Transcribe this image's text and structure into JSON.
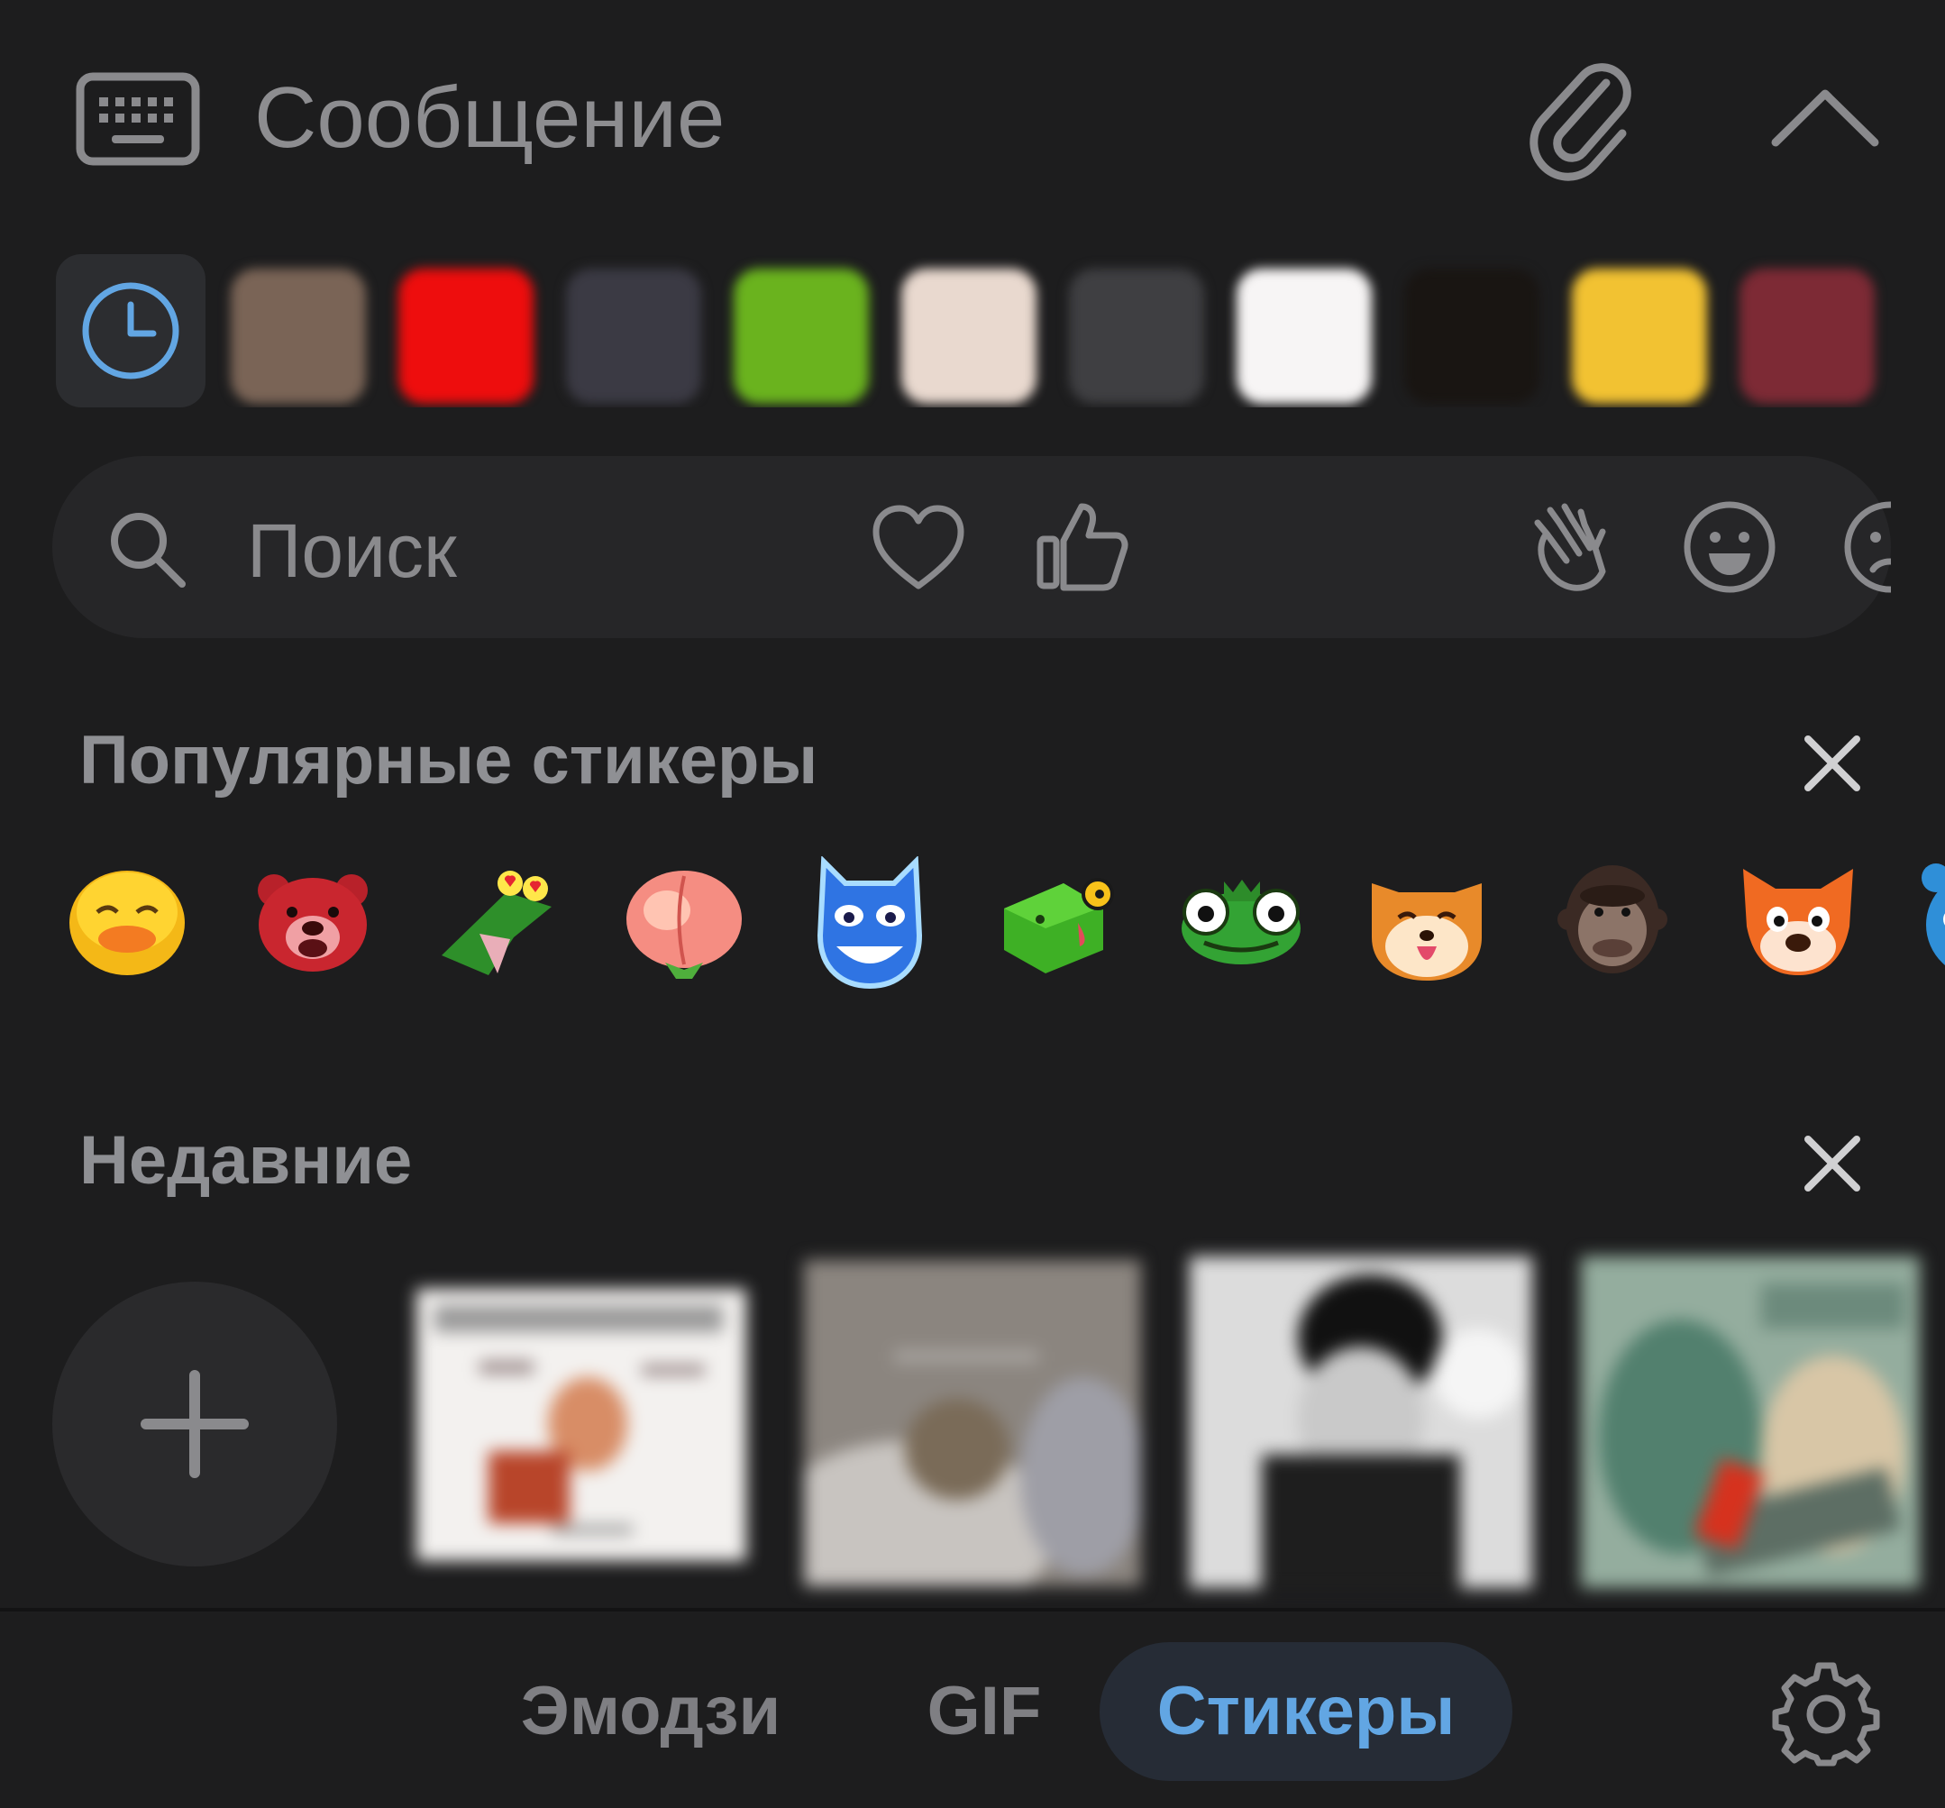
{
  "composer": {
    "placeholder": "Сообщение",
    "keyboard_icon": "keyboard-icon",
    "attach_icon": "paperclip-icon",
    "collapse_icon": "chevron-up-icon"
  },
  "pack_strip": {
    "recent_icon": "clock-icon",
    "accent": "#62a6e3",
    "packs": [
      {
        "name": "pack-1",
        "color": "#7a6456"
      },
      {
        "name": "pack-2",
        "color": "#ee0d0d"
      },
      {
        "name": "pack-3",
        "color": "#3b3a44"
      },
      {
        "name": "pack-4",
        "color": "#6ab31e"
      },
      {
        "name": "pack-5",
        "color": "#e9d9cf"
      },
      {
        "name": "pack-6",
        "color": "#3f3f42"
      },
      {
        "name": "pack-7",
        "color": "#f7f5f5"
      },
      {
        "name": "pack-8",
        "color": "#191512"
      },
      {
        "name": "pack-9",
        "color": "#f2c232"
      },
      {
        "name": "pack-10",
        "color": "#7d2a35"
      }
    ]
  },
  "search": {
    "placeholder": "Поиск",
    "icon": "search-icon",
    "categories": [
      "heart-icon",
      "thumbs-up-icon",
      "waving-hand-icon",
      "smiley-icon",
      "sad-face-icon"
    ]
  },
  "popular": {
    "title": "Популярные стикеры",
    "close_icon": "close-icon",
    "stickers": [
      "duck-sticker",
      "red-bear-sticker",
      "lizard-sticker",
      "peach-sticker",
      "blue-cat-sticker",
      "green-box-sticker",
      "frog-sticker",
      "shiba-sticker",
      "gorilla-sticker",
      "fox-sticker",
      "blue-monster-sticker"
    ]
  },
  "recent": {
    "title": "Недавние",
    "close_icon": "close-icon",
    "add_icon": "plus-icon",
    "stickers": [
      "recent-sticker-1",
      "recent-sticker-2",
      "recent-sticker-3",
      "recent-sticker-4"
    ]
  },
  "tabs": {
    "emoji": "Эмодзи",
    "gif": "GIF",
    "stickers": "Стикеры",
    "active": "stickers",
    "settings_icon": "gear-icon"
  }
}
